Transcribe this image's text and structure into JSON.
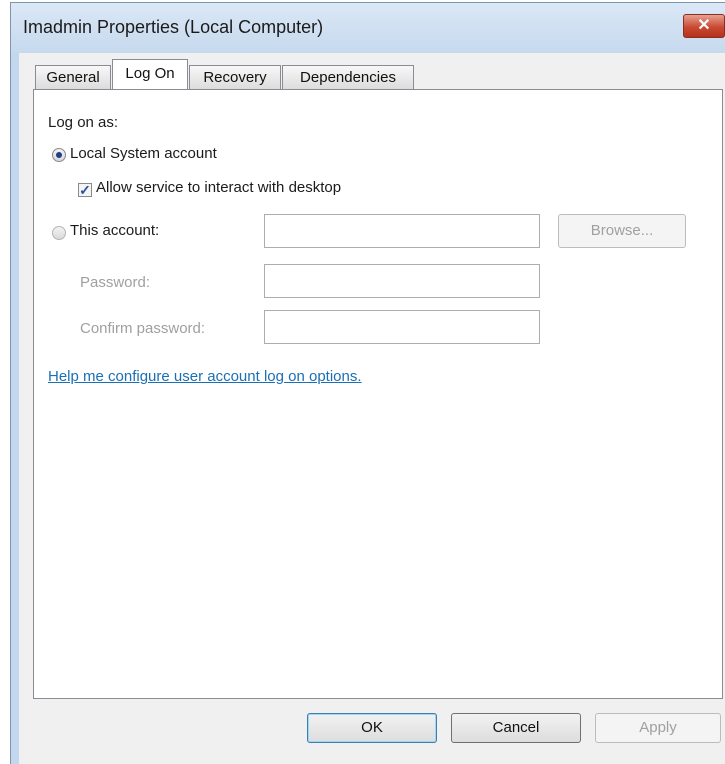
{
  "window": {
    "title": "Imadmin Properties (Local Computer)",
    "close_glyph": "✕"
  },
  "tabs": [
    {
      "label": "General"
    },
    {
      "label": "Log On"
    },
    {
      "label": "Recovery"
    },
    {
      "label": "Dependencies"
    }
  ],
  "active_tab": "Log On",
  "logon": {
    "section_label": "Log on as:",
    "local_system_label": "Local System account",
    "local_system_selected": true,
    "interact_label": "Allow service to interact with desktop",
    "interact_checked": true,
    "this_account_label": "This account:",
    "this_account_selected": false,
    "account_value": "",
    "browse_label": "Browse...",
    "password_label": "Password:",
    "password_value": "",
    "confirm_label": "Confirm password:",
    "confirm_value": "",
    "help_link": "Help me configure user account log on options."
  },
  "buttons": {
    "ok": "OK",
    "cancel": "Cancel",
    "apply": "Apply"
  },
  "icons": {
    "close": "close-icon",
    "check": "checkmark-icon"
  },
  "colors": {
    "title_bar": "#c6d9ee",
    "close_button": "#c84a33",
    "link": "#1b6fb5",
    "disabled_text": "#a0a0a0"
  }
}
